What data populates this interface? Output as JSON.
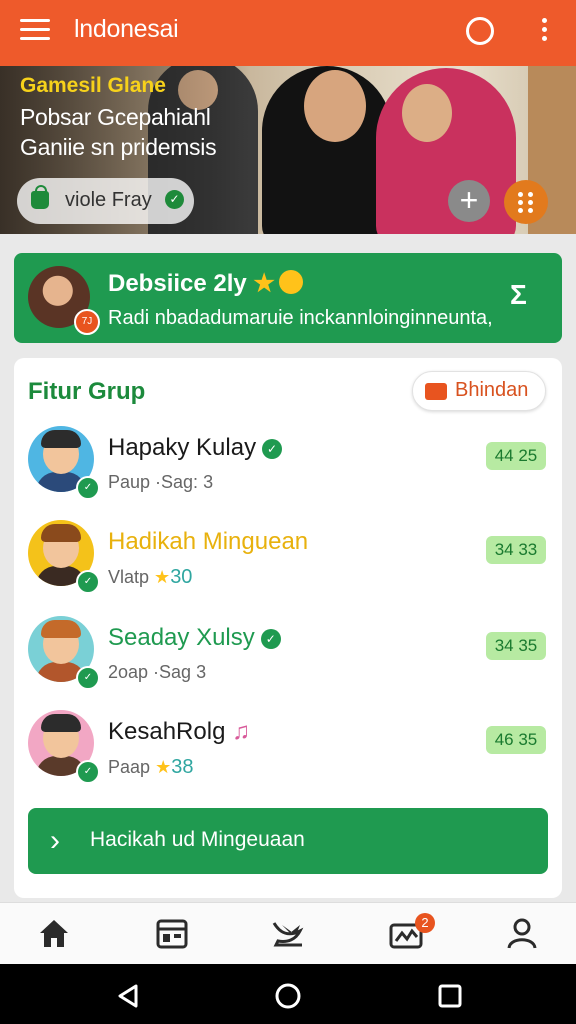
{
  "app": {
    "title": "lndonesai"
  },
  "hero": {
    "line1": "Gamesil Glane",
    "line2": "Pobsar Gcepahiahl",
    "line3": "Ganiie sn pridemsis",
    "pill_label": "viole Fray"
  },
  "promo": {
    "title": "Debsiice 2ly",
    "subtitle": "Radi nbadadumaruie inckannloinginneunta,",
    "badge": "7J"
  },
  "group": {
    "title": "Fitur Grup",
    "chip_label": "Bhindan",
    "rows": [
      {
        "name": "Hapaky Kulay",
        "sub": "Paup ·Sag: 3",
        "score": "44 25",
        "name_color": "#1a1a1a"
      },
      {
        "name": "Hadikah Minguean",
        "sub": "Vlatp",
        "sub_num": "30",
        "score": "34 33",
        "name_color": "#e8b10d"
      },
      {
        "name": "Seaday Xulsy",
        "sub": "2oap ·Sag 3",
        "score": "34 35",
        "name_color": "#1f9a50"
      },
      {
        "name": "KesahRolg",
        "sub": "Paap",
        "sub_num": "38",
        "score": "46 35",
        "name_color": "#1a1a1a"
      }
    ],
    "button_label": "Hacikah ud Mingeuaan"
  },
  "bottom_nav": {
    "items": [
      "home-icon",
      "calendar-icon",
      "bird-icon",
      "briefcase-icon",
      "profile-icon"
    ],
    "notification_count": "2"
  },
  "colors": {
    "primary": "#ee5a2b",
    "green": "#1f9a50",
    "score_bg": "#b7eaa2"
  }
}
